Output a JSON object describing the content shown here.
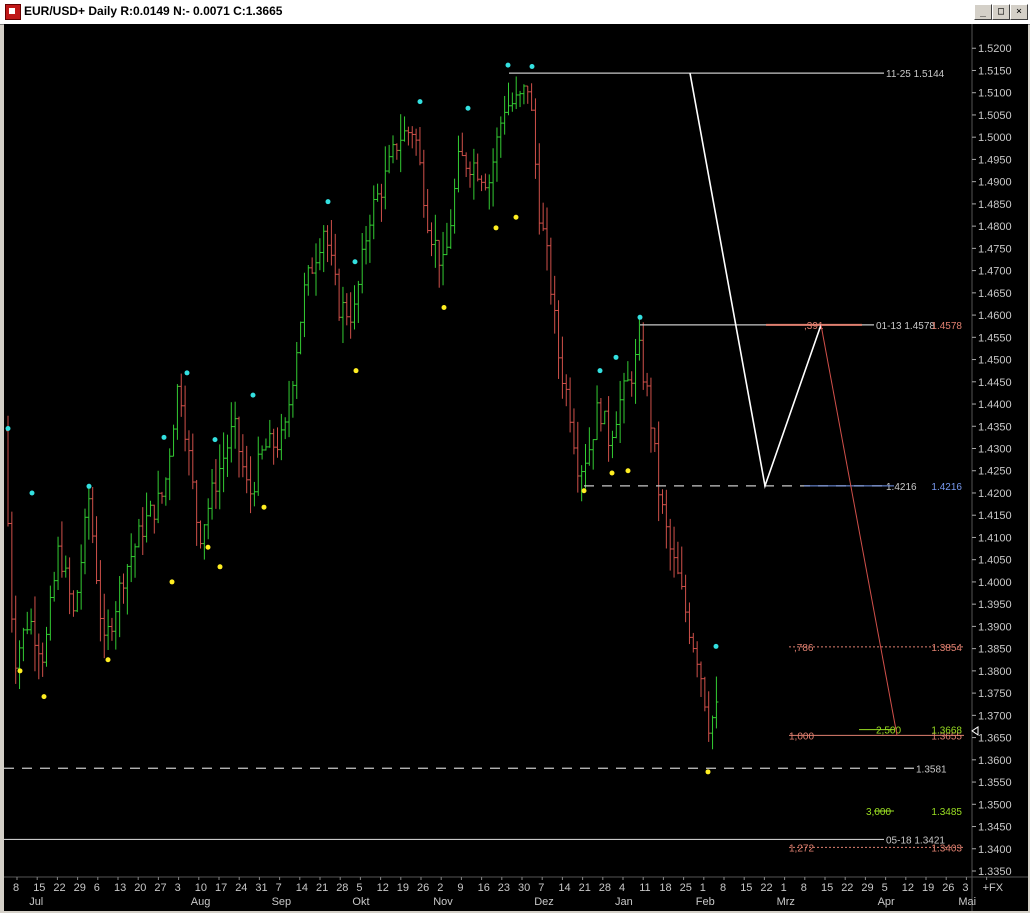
{
  "window": {
    "title": "EUR/USD+ Daily R:0.0149 N:- 0.0071 C:1.3665",
    "buttons": [
      "_",
      "□",
      "×"
    ]
  },
  "colors": {
    "background": "#000000",
    "up_bar": "#33cc33",
    "down_bar": "#d0504a",
    "swing_high_dot": "#33e0e0",
    "swing_low_dot": "#ffee22",
    "level_line": "#c8c8c8",
    "fib_label": "#e08070",
    "ext_green": "#99dd22",
    "projection": "#ffffff",
    "axis_text": "#c8c8c8"
  },
  "chart_data": {
    "type": "ohlc",
    "symbol": "EUR/USD+",
    "timeframe": "Daily",
    "ylim": [
      1.335,
      1.525
    ],
    "y_ticks": [
      "1.5200",
      "1.5150",
      "1.5100",
      "1.5050",
      "1.5000",
      "1.4950",
      "1.4900",
      "1.4850",
      "1.4800",
      "1.4750",
      "1.4700",
      "1.4650",
      "1.4600",
      "1.4550",
      "1.4500",
      "1.4450",
      "1.4400",
      "1.4350",
      "1.4300",
      "1.4250",
      "1.4200",
      "1.4150",
      "1.4100",
      "1.4050",
      "1.4000",
      "1.3950",
      "1.3900",
      "1.3850",
      "1.3800",
      "1.3750",
      "1.3700",
      "1.3650",
      "1.3600",
      "1.3550",
      "1.3500",
      "1.3450",
      "1.3400",
      "1.3350"
    ],
    "x_day_labels": [
      "8",
      "15",
      "22",
      "29",
      "6",
      "13",
      "20",
      "27",
      "3",
      "10",
      "17",
      "24",
      "31",
      "7",
      "14",
      "21",
      "28",
      "5",
      "12",
      "19",
      "26",
      "2",
      "9",
      "16",
      "23",
      "30",
      "7",
      "14",
      "21",
      "28",
      "4",
      "11",
      "18",
      "25",
      "1",
      "8",
      "15",
      "22",
      "1",
      "8",
      "15",
      "22",
      "29",
      "5",
      "12",
      "19",
      "26",
      "3",
      "+FX"
    ],
    "x_month_labels": [
      {
        "label": "Jul",
        "at": 1
      },
      {
        "label": "Aug",
        "at": 9
      },
      {
        "label": "Sep",
        "at": 13
      },
      {
        "label": "Okt",
        "at": 17
      },
      {
        "label": "Nov",
        "at": 21
      },
      {
        "label": "Dez",
        "at": 26
      },
      {
        "label": "Jan",
        "at": 30
      },
      {
        "label": "Feb",
        "at": 34
      },
      {
        "label": "Mrz",
        "at": 38
      },
      {
        "label": "Apr",
        "at": 43
      },
      {
        "label": "Mai",
        "at": 47
      }
    ],
    "last_price": 1.3665,
    "levels": [
      {
        "name": "swing-high",
        "label": "11-25  1.5144",
        "price": 1.5144,
        "style": "solid",
        "color": "#c8c8c8"
      },
      {
        "name": "pivot-high",
        "label": "01-13  1.4578",
        "price": 1.4578,
        "style": "solid",
        "color": "#c8c8c8"
      },
      {
        "name": "pivot-low",
        "label": "1.4216",
        "price": 1.4216,
        "style": "dashed",
        "color": "#c8c8c8"
      },
      {
        "name": "support",
        "label": "1.3581",
        "price": 1.3581,
        "style": "dashed",
        "color": "#c8c8c8"
      },
      {
        "name": "old-low",
        "label": "05-18  1.3421",
        "price": 1.3421,
        "style": "solid",
        "color": "#c8c8c8"
      }
    ],
    "fib_levels": [
      {
        "ratio": ",391",
        "price": 1.4578,
        "value_label": "1.4578",
        "color": "#e08070"
      },
      {
        "ratio": ",786",
        "price": 1.3854,
        "value_label": "1.3854",
        "color": "#e08070"
      },
      {
        "ratio": "1,000",
        "price": 1.3655,
        "value_label": "1.3655",
        "color": "#e08070"
      },
      {
        "ratio": "1,272",
        "price": 1.3403,
        "value_label": "1.3403",
        "color": "#e08070"
      },
      {
        "ratio": "2,500",
        "price": 1.3668,
        "value_label": "1.3668",
        "color": "#99dd22"
      },
      {
        "ratio": "3,000",
        "price": 1.3485,
        "value_label": "1.3485",
        "color": "#99dd22"
      },
      {
        "ratio": "",
        "price": 1.4216,
        "value_label": "1.4216",
        "color": "#7799ee"
      }
    ]
  }
}
